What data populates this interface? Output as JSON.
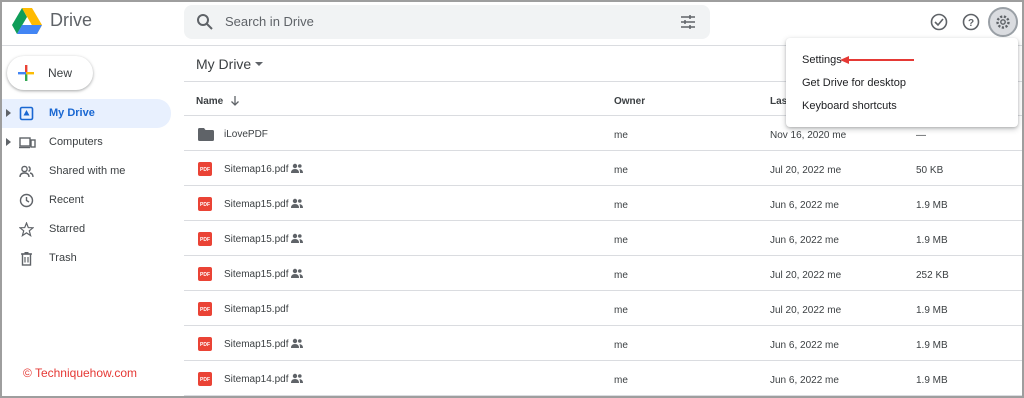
{
  "header": {
    "app_title": "Drive",
    "search_placeholder": "Search in Drive",
    "icons": [
      "drive-logo",
      "search-icon",
      "filter-icon",
      "offline-check-icon",
      "help-icon",
      "settings-icon"
    ]
  },
  "sidebar": {
    "new_label": "New",
    "items": [
      {
        "label": "My Drive",
        "icon": "my-drive-icon",
        "active": true,
        "expandable": true
      },
      {
        "label": "Computers",
        "icon": "computers-icon",
        "active": false,
        "expandable": true
      },
      {
        "label": "Shared with me",
        "icon": "shared-icon",
        "active": false,
        "expandable": false
      },
      {
        "label": "Recent",
        "icon": "clock-icon",
        "active": false,
        "expandable": false
      },
      {
        "label": "Starred",
        "icon": "star-icon",
        "active": false,
        "expandable": false
      },
      {
        "label": "Trash",
        "icon": "trash-icon",
        "active": false,
        "expandable": false
      }
    ]
  },
  "main": {
    "title": "My Drive",
    "columns": {
      "name": "Name",
      "owner": "Owner",
      "modified": "Las"
    },
    "rows": [
      {
        "name": "iLovePDF",
        "type": "folder",
        "shared": false,
        "owner": "me",
        "modified": "Nov 16, 2020 me",
        "size": "—"
      },
      {
        "name": "Sitemap16.pdf",
        "type": "pdf",
        "shared": true,
        "owner": "me",
        "modified": "Jul 20, 2022 me",
        "size": "50 KB"
      },
      {
        "name": "Sitemap15.pdf",
        "type": "pdf",
        "shared": true,
        "owner": "me",
        "modified": "Jun 6, 2022 me",
        "size": "1.9 MB"
      },
      {
        "name": "Sitemap15.pdf",
        "type": "pdf",
        "shared": true,
        "owner": "me",
        "modified": "Jun 6, 2022 me",
        "size": "1.9 MB"
      },
      {
        "name": "Sitemap15.pdf",
        "type": "pdf",
        "shared": true,
        "owner": "me",
        "modified": "Jul 20, 2022 me",
        "size": "252 KB"
      },
      {
        "name": "Sitemap15.pdf",
        "type": "pdf",
        "shared": false,
        "owner": "me",
        "modified": "Jul 20, 2022 me",
        "size": "1.9 MB"
      },
      {
        "name": "Sitemap15.pdf",
        "type": "pdf",
        "shared": true,
        "owner": "me",
        "modified": "Jun 6, 2022 me",
        "size": "1.9 MB"
      },
      {
        "name": "Sitemap14.pdf",
        "type": "pdf",
        "shared": true,
        "owner": "me",
        "modified": "Jun 6, 2022 me",
        "size": "1.9 MB"
      }
    ]
  },
  "settings_menu": {
    "items": [
      "Settings",
      "Get Drive for desktop",
      "Keyboard shortcuts"
    ]
  },
  "watermark": "© Techniquehow.com",
  "colors": {
    "accent": "#1967d2",
    "active_bg": "#e8f0fe",
    "pdf_red": "#ea4335",
    "annotation_red": "#e53935"
  }
}
